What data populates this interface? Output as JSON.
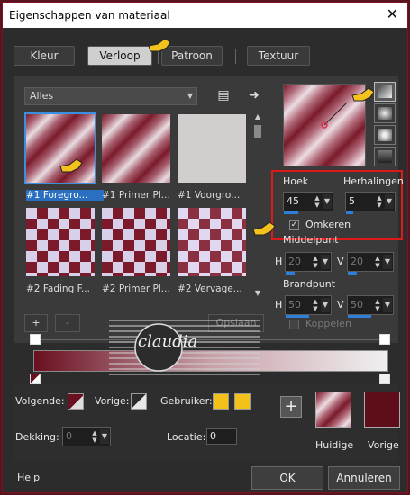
{
  "window": {
    "title": "Eigenschappen van materiaal"
  },
  "tabs": [
    {
      "label": "Kleur",
      "active": false
    },
    {
      "label": "Verloop",
      "active": true
    },
    {
      "label": "Patroon",
      "active": false
    },
    {
      "label": "Textuur",
      "active": false
    }
  ],
  "category": {
    "selected": "Alles"
  },
  "thumbnails": [
    {
      "label": "#1 Foregro...",
      "selected": true
    },
    {
      "label": "#1 Primer Pl...",
      "selected": false
    },
    {
      "label": "#1 Voorgro...",
      "selected": false
    },
    {
      "label": "#2 Fading F...",
      "selected": false
    },
    {
      "label": "#2 Primer Pl...",
      "selected": false
    },
    {
      "label": "#2 Vervage...",
      "selected": false
    }
  ],
  "params": {
    "hoek_label": "Hoek",
    "hoek_value": "45",
    "herhalingen_label": "Herhalingen",
    "herhalingen_value": "5",
    "omkeren_label": "Omkeren",
    "omkeren_checked": true,
    "middelpunt_label": "Middelpunt",
    "brandpunt_label": "Brandpunt",
    "h_label": "H",
    "v_label": "V",
    "mid_h": "20",
    "mid_v": "20",
    "brand_h": "50",
    "brand_v": "50",
    "koppelen_label": "Koppelen"
  },
  "editor": {
    "add": "+",
    "remove": "-",
    "save_label": "Opslaan"
  },
  "lower": {
    "volgende_label": "Volgende:",
    "vorige_label": "Vorige:",
    "gebruiker_label": "Gebruiker:",
    "dekking_label": "Dekking:",
    "dekking_value": "0",
    "locatie_label": "Locatie:",
    "locatie_value": "0",
    "huidige_label": "Huidige",
    "vorige_swatch_label": "Vorige",
    "plus": "+"
  },
  "footer": {
    "help": "Help",
    "ok": "OK",
    "cancel": "Annuleren"
  },
  "watermark": {
    "text": "claudia"
  },
  "colors": {
    "accent": "#2d7fd8",
    "highlight": "#e01818",
    "wine": "#5a1420",
    "user_yellow": "#f2c21a"
  }
}
